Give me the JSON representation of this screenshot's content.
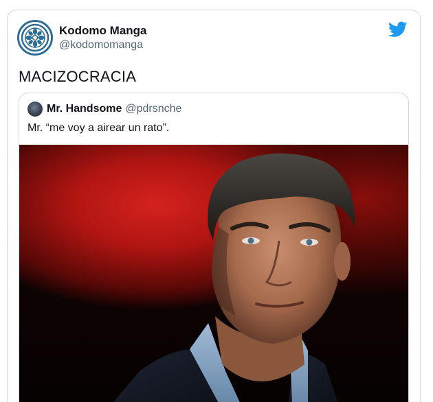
{
  "tweet": {
    "author": {
      "display_name": "Kodomo Manga",
      "handle": "@kodomomanga",
      "avatar_icon": "wheel-logo-icon"
    },
    "platform_icon": "twitter-bird-icon",
    "text": "MACIZOCRACIA"
  },
  "quoted_tweet": {
    "author": {
      "display_name": "Mr. Handsome",
      "handle": "@pdrsnche",
      "avatar_icon": "avatar-photo"
    },
    "text": "Mr. “me voy a airear un rato”.",
    "media": {
      "type": "photo",
      "subject": "photo"
    }
  },
  "colors": {
    "twitter_blue": "#1d9bf0",
    "border": "#cfd9de",
    "secondary_text": "#536471",
    "logo_blue": "#2d6d96"
  }
}
